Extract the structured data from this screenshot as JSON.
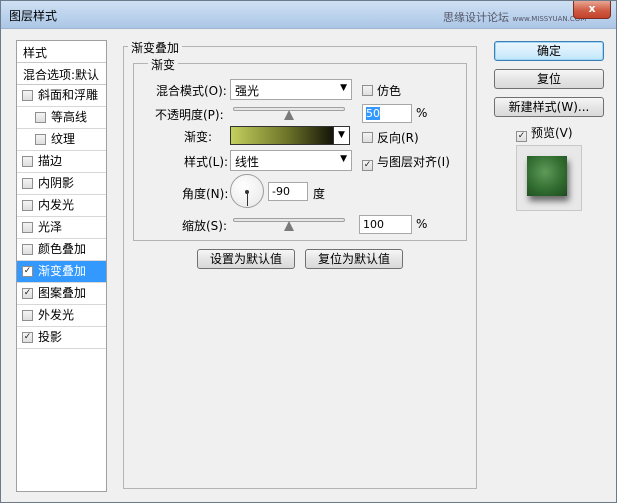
{
  "window": {
    "title": "图层样式",
    "watermark": "思缘设计论坛",
    "watermark_url": "www.MISSYUAN.COM",
    "close_label": "x"
  },
  "style_list": {
    "header": "样式",
    "blend_options": "混合选项:默认",
    "items": [
      {
        "label": "斜面和浮雕",
        "checked": false
      },
      {
        "label": "等高线",
        "checked": false
      },
      {
        "label": "纹理",
        "checked": false
      },
      {
        "label": "描边",
        "checked": false
      },
      {
        "label": "内阴影",
        "checked": false
      },
      {
        "label": "内发光",
        "checked": false
      },
      {
        "label": "光泽",
        "checked": false
      },
      {
        "label": "颜色叠加",
        "checked": false
      },
      {
        "label": "渐变叠加",
        "checked": true
      },
      {
        "label": "图案叠加",
        "checked": true
      },
      {
        "label": "外发光",
        "checked": false
      },
      {
        "label": "投影",
        "checked": true
      }
    ]
  },
  "gradient_overlay": {
    "group_title": "渐变叠加",
    "sub_title": "渐变",
    "blend_mode_label": "混合模式(O):",
    "blend_mode_value": "强光",
    "dither_label": "仿色",
    "opacity_label": "不透明度(P):",
    "opacity_value": "50",
    "opacity_fraction": 0.5,
    "percent": "%",
    "gradient_label": "渐变:",
    "reverse_label": "反向(R)",
    "style_label": "样式(L):",
    "style_value": "线性",
    "align_label": "与图层对齐(I)",
    "angle_label": "角度(N):",
    "angle_value": "-90",
    "degree_label": "度",
    "scale_label": "缩放(S):",
    "scale_value": "100",
    "scale_fraction": 0.5,
    "gradient_colors": [
      "#c3d05e",
      "#6d7428",
      "#141409"
    ],
    "make_default_label": "设置为默认值",
    "reset_default_label": "复位为默认值"
  },
  "side_buttons": {
    "ok": "确定",
    "reset": "复位",
    "new_style": "新建样式(W)...",
    "preview_label": "预览(V)"
  },
  "icons": {
    "checkbox_checked": "checkmark-icon",
    "dropdown": "chevron-down-icon",
    "close": "close-icon"
  }
}
